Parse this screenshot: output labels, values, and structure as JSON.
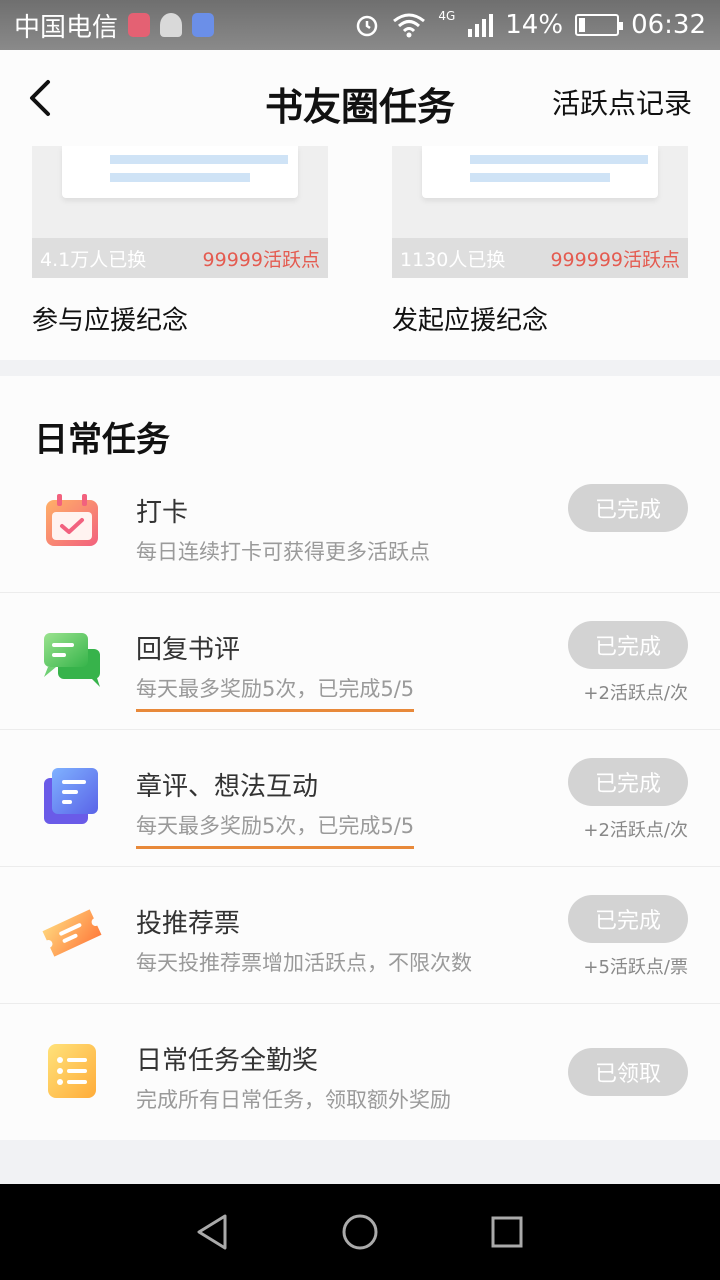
{
  "status_bar": {
    "carrier": "中国电信",
    "network": "4G",
    "battery": "14%",
    "time": "06:32"
  },
  "header": {
    "title": "书友圈任务",
    "link": "活跃点记录"
  },
  "rewards": [
    {
      "count": "4.1万人已换",
      "price": "99999活跃点",
      "name": "参与应援纪念"
    },
    {
      "count": "1130人已换",
      "price": "999999活跃点",
      "name": "发起应援纪念"
    }
  ],
  "daily": {
    "title": "日常任务",
    "tasks": [
      {
        "name": "打卡",
        "desc": "每日连续打卡可获得更多活跃点",
        "button": "已完成",
        "note": ""
      },
      {
        "name": "回复书评",
        "desc": "每天最多奖励5次，已完成5/5",
        "button": "已完成",
        "note": "+2活跃点/次"
      },
      {
        "name": "章评、想法互动",
        "desc": "每天最多奖励5次，已完成5/5",
        "button": "已完成",
        "note": "+2活跃点/次"
      },
      {
        "name": "投推荐票",
        "desc": "每天投推荐票增加活跃点，不限次数",
        "button": "已完成",
        "note": "+5活跃点/票"
      },
      {
        "name": "日常任务全勤奖",
        "desc": "完成所有日常任务，领取额外奖励",
        "button": "已领取",
        "note": ""
      }
    ]
  },
  "icons": {
    "checkin": "calendar-check-icon",
    "reply": "chat-bubble-icon",
    "chapter": "document-icon",
    "vote": "ticket-icon",
    "attendance": "list-icon"
  }
}
